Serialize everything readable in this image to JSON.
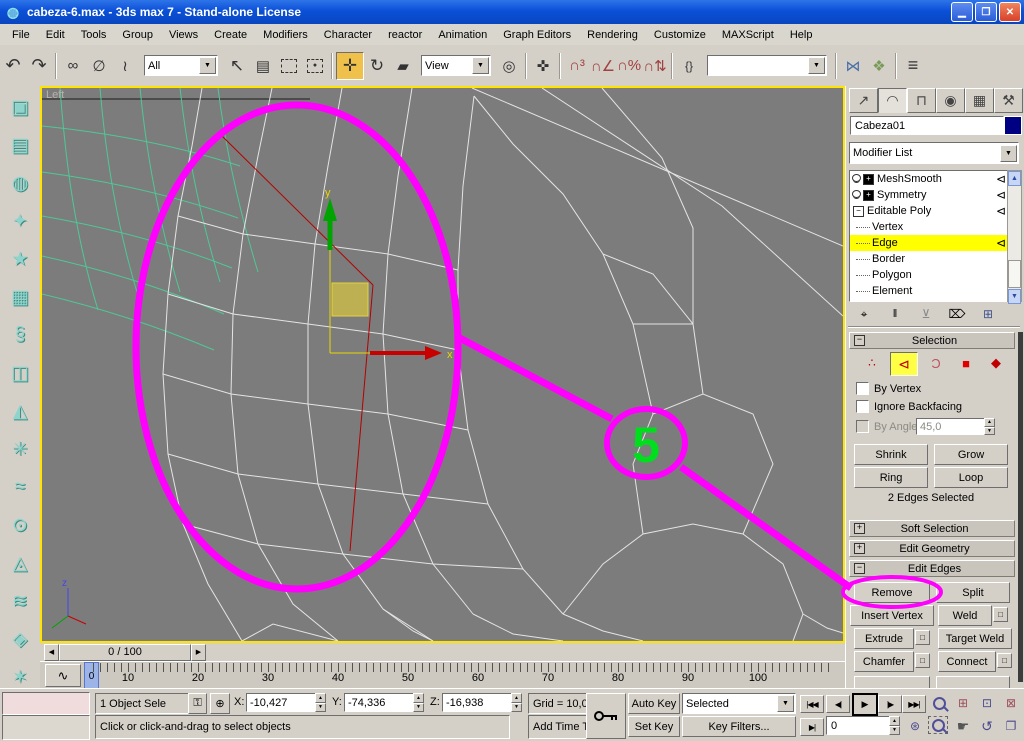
{
  "window": {
    "title": "cabeza-6.max - 3ds max 7  - Stand-alone License"
  },
  "icons": {
    "app": "◍",
    "minimize": "▁",
    "restore": "❐",
    "close": "✕",
    "undo": "↶",
    "redo": "↷",
    "link": "∞",
    "unlink": "∅",
    "bind_spacewarp": "≀",
    "select": "↖",
    "select_by_name": "▤",
    "move": "✛",
    "rotate": "↻",
    "scale": "▰",
    "use_center": "◎",
    "manipulate": "✜",
    "snap3": "∩³",
    "snap_angle": "∩∠",
    "snap_percent": "∩%",
    "snap_spinner": "∩⇅",
    "named_sets": "{}",
    "mirror": "⋈",
    "align": "❖",
    "layers": "≡",
    "tab_create": "↗",
    "tab_modify": "◠",
    "tab_hierarchy": "⊓",
    "tab_motion": "◉",
    "tab_display": "▦",
    "tab_utilities": "⚒",
    "active_arrow": "⊲",
    "pin_stack": "⌖",
    "show_end_result": "‖",
    "make_unique": "⊻",
    "remove_modifier": "⌦",
    "configure_sets": "⊞",
    "so_vertex": "∴",
    "so_edge": "⊲",
    "so_border": "Ɔ",
    "so_polygon": "■",
    "so_element": "◆",
    "prev_arrow": "◀",
    "next_arrow": "▶",
    "play_start": "|◀◀",
    "play_prev": "◀|",
    "play": "▶",
    "play_next": "|▶",
    "play_end": "▶▶|",
    "key_mode": "▶|",
    "zoom_all": "⊞",
    "zoom_extents": "⊡",
    "zoom_extents_all": "⊠",
    "pan_hand": "☛",
    "arc_rotate": "↺",
    "minmax_toggle": "❐",
    "curve_editor": "∿",
    "lock": "⚿",
    "abs_offset": "⊕",
    "time_config": "⊛"
  },
  "menu": {
    "items": [
      {
        "name": "menu-file",
        "label": "File"
      },
      {
        "name": "menu-edit",
        "label": "Edit"
      },
      {
        "name": "menu-tools",
        "label": "Tools"
      },
      {
        "name": "menu-group",
        "label": "Group"
      },
      {
        "name": "menu-views",
        "label": "Views"
      },
      {
        "name": "menu-create",
        "label": "Create"
      },
      {
        "name": "menu-modifiers",
        "label": "Modifiers"
      },
      {
        "name": "menu-character",
        "label": "Character"
      },
      {
        "name": "menu-reactor",
        "label": "reactor"
      },
      {
        "name": "menu-animation",
        "label": "Animation"
      },
      {
        "name": "menu-graph-editors",
        "label": "Graph Editors"
      },
      {
        "name": "menu-rendering",
        "label": "Rendering"
      },
      {
        "name": "menu-customize",
        "label": "Customize"
      },
      {
        "name": "menu-maxscript",
        "label": "MAXScript"
      },
      {
        "name": "menu-help",
        "label": "Help"
      }
    ]
  },
  "toolbar": {
    "filter_value": "All",
    "ref_coord_value": "View",
    "named_selection_value": ""
  },
  "left_toolbar": {
    "items": [
      {
        "name": "rigid-body-collection-icon",
        "glyph": "▣"
      },
      {
        "name": "cloth-collection-icon",
        "glyph": "▤"
      },
      {
        "name": "soft-body-collection-icon",
        "glyph": "◍"
      },
      {
        "name": "rope-collection-icon",
        "glyph": "✦"
      },
      {
        "name": "deforming-mesh-collection-icon",
        "glyph": "★"
      },
      {
        "name": "plane-icon",
        "glyph": "▦"
      },
      {
        "name": "spring-icon",
        "glyph": "§"
      },
      {
        "name": "linear-dashpot-icon",
        "glyph": "◫"
      },
      {
        "name": "angular-dashpot-icon",
        "glyph": "◭"
      },
      {
        "name": "motor-icon",
        "glyph": "✳"
      },
      {
        "name": "wind-icon",
        "glyph": "≈"
      },
      {
        "name": "toy-car-icon",
        "glyph": "⊙"
      },
      {
        "name": "fracture-icon",
        "glyph": "◬"
      },
      {
        "name": "water-icon",
        "glyph": "≋"
      },
      {
        "name": "constraint-solver-icon",
        "glyph": "◈"
      },
      {
        "name": "ragdoll-constraint-icon",
        "glyph": "✶"
      },
      {
        "name": "hinge-constraint-icon",
        "glyph": "◢"
      }
    ]
  },
  "viewport": {
    "label": "Left",
    "axis_x": "x",
    "axis_y": "y",
    "axis_z": "z"
  },
  "annotation": {
    "step_number": "5",
    "circle_color": "#FF00FF",
    "number_color": "#00DE1E"
  },
  "command_panel": {
    "object_name": "Cabeza01",
    "modifier_list_label": "Modifier List",
    "stack": {
      "meshsmooth": "MeshSmooth",
      "symmetry": "Symmetry",
      "editable_poly": "Editable Poly",
      "vertex": "Vertex",
      "edge": "Edge",
      "border": "Border",
      "polygon": "Polygon",
      "element": "Element"
    },
    "selection": {
      "title": "Selection",
      "by_vertex": "By Vertex",
      "ignore_backfacing": "Ignore Backfacing",
      "by_angle": "By Angle:",
      "by_angle_value": "45,0",
      "shrink": "Shrink",
      "grow": "Grow",
      "ring": "Ring",
      "loop": "Loop",
      "status": "2 Edges Selected"
    },
    "rollouts": {
      "soft_selection": "Soft Selection",
      "edit_geometry": "Edit Geometry",
      "edit_edges": "Edit Edges"
    },
    "edit_edges": {
      "remove": "Remove",
      "split": "Split",
      "insert_vertex": "Insert Vertex",
      "weld": "Weld",
      "extrude": "Extrude",
      "target_weld": "Target Weld",
      "chamfer": "Chamfer",
      "connect": "Connect"
    }
  },
  "timeline": {
    "slider_value": "0 / 100",
    "handle": "0",
    "ticks": [
      "10",
      "20",
      "30",
      "40",
      "50",
      "60",
      "70",
      "80",
      "90",
      "100"
    ]
  },
  "status_bar": {
    "selection_status": "1 Object Sele",
    "x_label": "X:",
    "x_value": "-10,427",
    "y_label": "Y:",
    "y_value": "-74,336",
    "z_label": "Z:",
    "z_value": "-16,938",
    "grid": "Grid = 10,0",
    "prompt": "Click or click-and-drag to select objects",
    "add_time_tag": "Add Time Tag",
    "auto_key": "Auto Key",
    "set_key": "Set Key",
    "key_filter_value": "Selected",
    "key_filters": "Key Filters...",
    "frame": "0"
  }
}
